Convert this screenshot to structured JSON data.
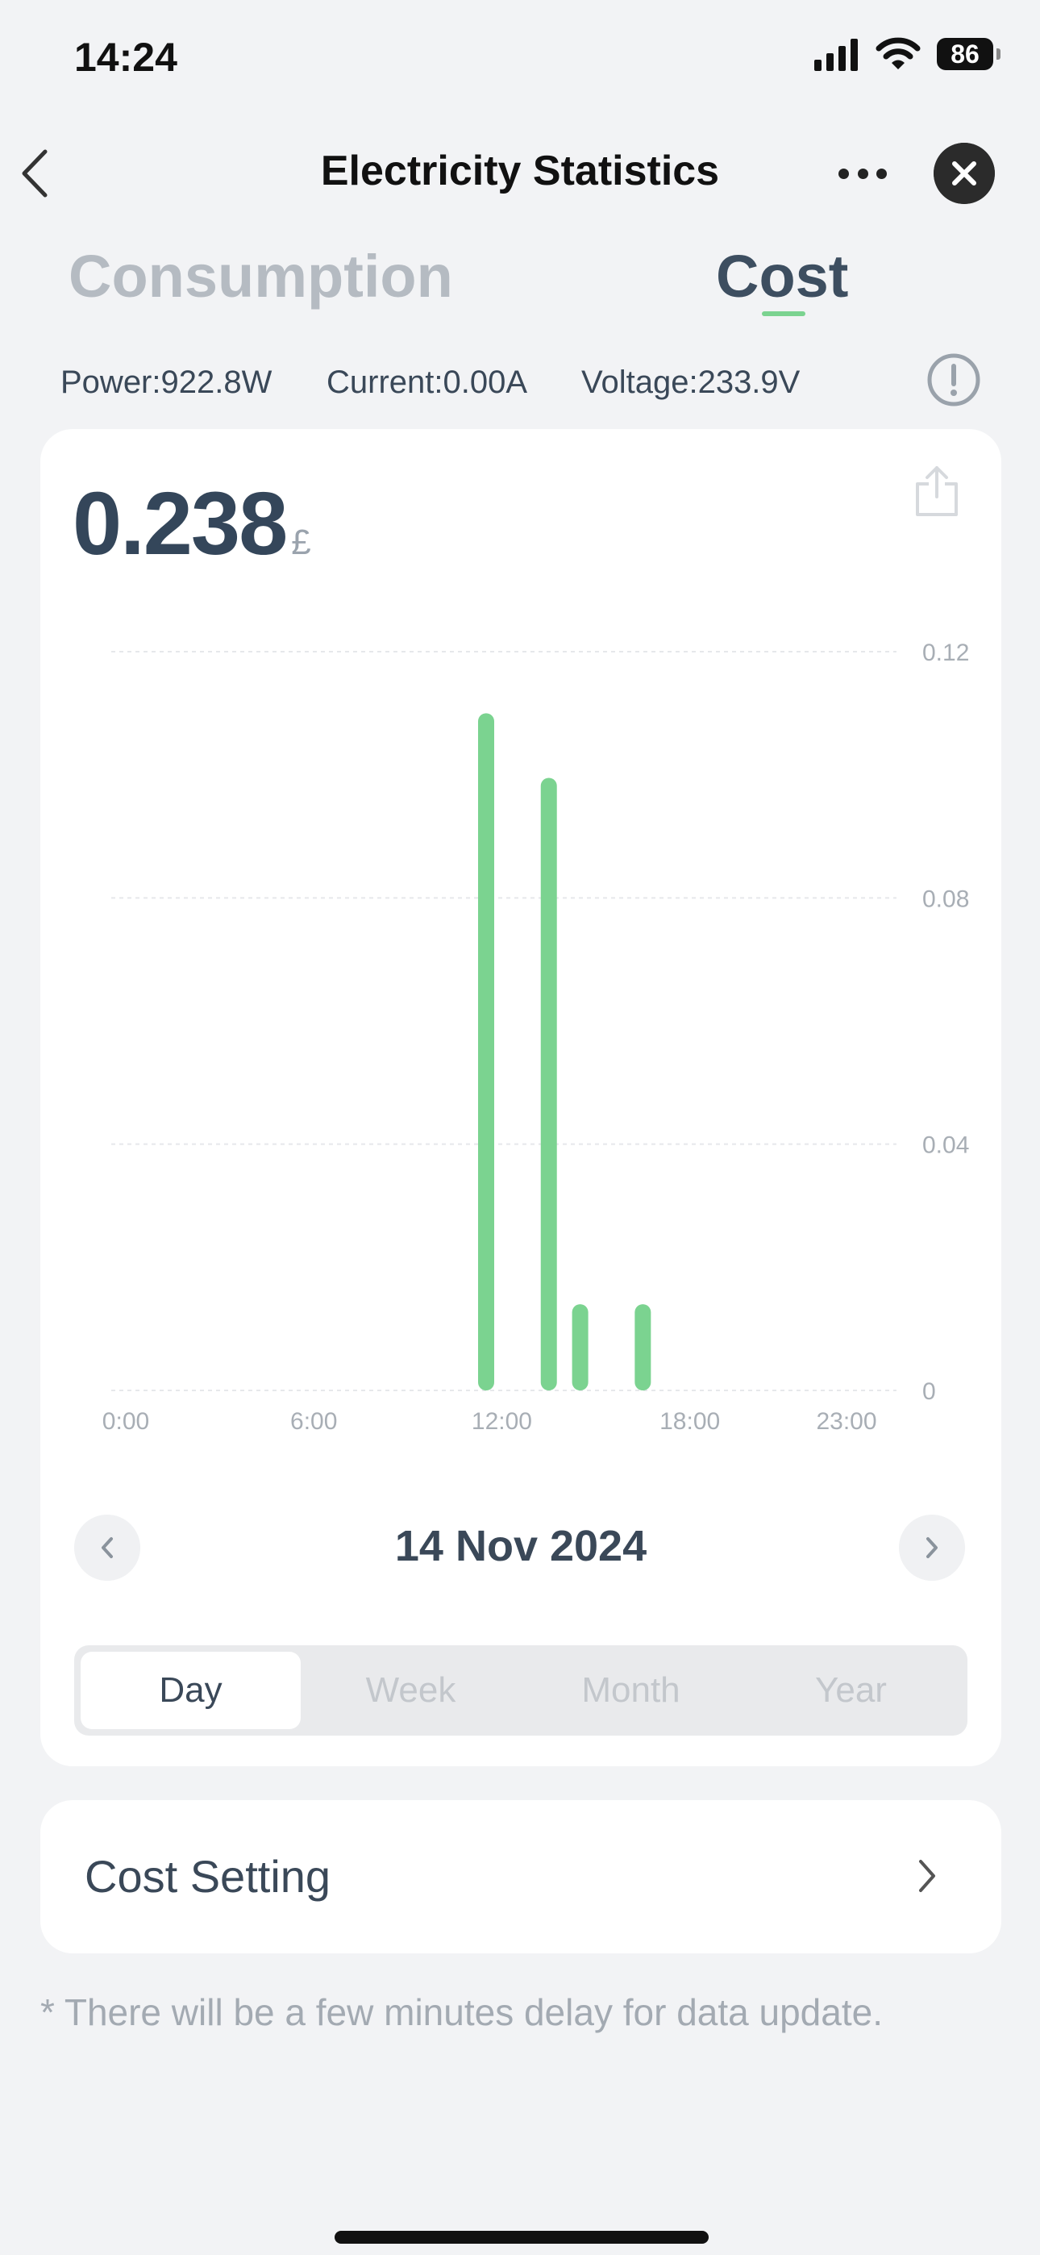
{
  "status": {
    "time": "14:24",
    "battery": "86"
  },
  "nav": {
    "title": "Electricity Statistics"
  },
  "tabs": [
    {
      "label": "Consumption",
      "active": false
    },
    {
      "label": "Cost",
      "active": true
    }
  ],
  "readings": {
    "power": "Power:922.8W",
    "current": "Current:0.00A",
    "voltage": "Voltage:233.9V"
  },
  "summary": {
    "total": "0.238",
    "unit": "£"
  },
  "chart_data": {
    "type": "bar",
    "x_ticks": [
      "0:00",
      "6:00",
      "12:00",
      "18:00",
      "23:00"
    ],
    "y_ticks": [
      "0.12",
      "0.08",
      "0.04",
      "0"
    ],
    "ylim": [
      0,
      0.12
    ],
    "xlim": [
      0,
      23
    ],
    "bars": [
      {
        "hour": 11,
        "value": 0.11
      },
      {
        "hour": 13,
        "value": 0.0995
      },
      {
        "hour": 14,
        "value": 0.014
      },
      {
        "hour": 16,
        "value": 0.014
      }
    ],
    "color": "#7bd390",
    "grid": true,
    "y_axis_side": "right"
  },
  "date": {
    "label": "14 Nov 2024"
  },
  "period": [
    {
      "label": "Day",
      "active": true
    },
    {
      "label": "Week",
      "active": false
    },
    {
      "label": "Month",
      "active": false
    },
    {
      "label": "Year",
      "active": false
    }
  ],
  "cost_setting": {
    "label": "Cost Setting"
  },
  "footnote": "* There will be a few minutes delay for data update.",
  "colors": {
    "accent": "#7bd390",
    "text": "#3a4858",
    "muted": "#b5bbc2",
    "background": "#f2f3f5"
  }
}
